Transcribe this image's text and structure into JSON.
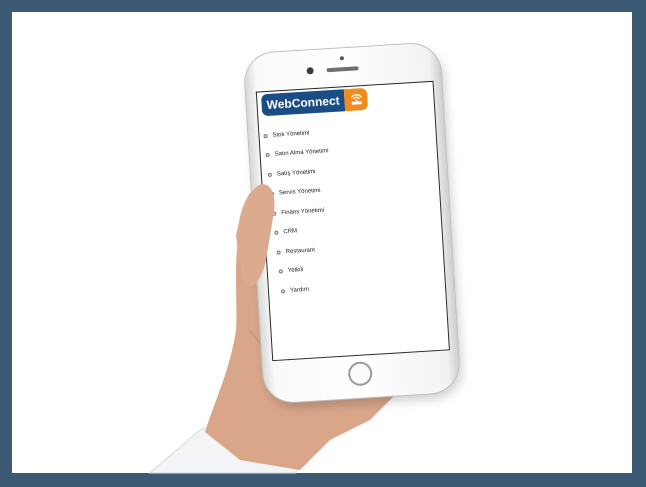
{
  "brand": {
    "name": "WebConnect",
    "badge_icon": "wireless-router-icon",
    "primary_color": "#1a4d86",
    "accent_color": "#f08c1c",
    "frame_color": "#3c5a73"
  },
  "menu": {
    "items": [
      {
        "label": "Stok Yönetimi"
      },
      {
        "label": "Satın Alma Yönetimi"
      },
      {
        "label": "Satış Yönetimi"
      },
      {
        "label": "Servis Yönetimi"
      },
      {
        "label": "Finans Yönetimi"
      },
      {
        "label": "CRM"
      },
      {
        "label": "Restaurant"
      },
      {
        "label": "Yetkili"
      },
      {
        "label": "Yardım"
      }
    ]
  }
}
